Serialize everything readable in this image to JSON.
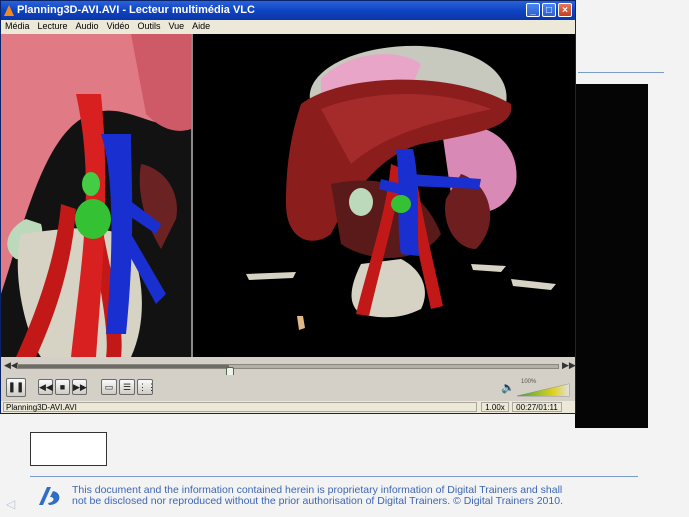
{
  "window": {
    "title": "Planning3D-AVI.AVI - Lecteur multimédia VLC",
    "minimize_glyph": "_",
    "maximize_glyph": "□",
    "close_glyph": "×"
  },
  "menu": {
    "items": [
      "Média",
      "Lecture",
      "Audio",
      "Vidéo",
      "Outils",
      "Vue",
      "Aide"
    ]
  },
  "player": {
    "seek_progress": 0.39,
    "seek_back_glyph": "◀◀",
    "seek_forward_glyph": "▶▶",
    "buttons": {
      "pause": "❚❚",
      "previous": "◀◀",
      "stop": "■",
      "next": "▶▶",
      "fullscreen": "▭",
      "playlist": "☰",
      "extended": "⋮⋮"
    },
    "volume_percent_label": "100%",
    "volume_level": 1.0,
    "volume_icon": "speaker-icon"
  },
  "status": {
    "filename": "Planning3D-AVI.AVI",
    "speed": "1.00x",
    "time": "00:27/01:11"
  },
  "background": {
    "footer_text_line1": "This document and the information contained herein is proprietary information of Digital Trainers and shall",
    "footer_text_line2": "not be disclosed nor reproduced without the prior authorisation of Digital Trainers.  © Digital Trainers 2010."
  },
  "colors": {
    "titlebar": "#0f44c2",
    "footer_text": "#3d67b3",
    "vessel_red": "#c21818",
    "vessel_blue": "#1a2fd0",
    "liver": "#8c1d1d"
  }
}
